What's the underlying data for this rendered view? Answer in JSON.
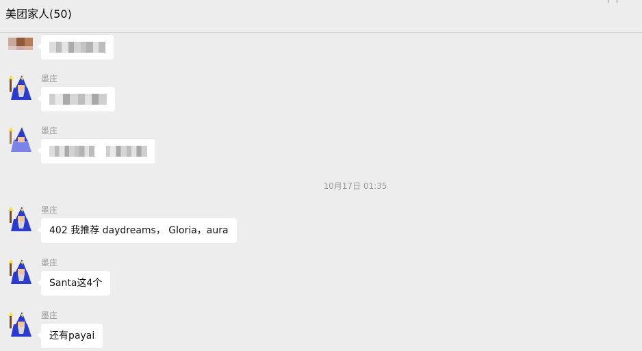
{
  "header": {
    "chat_title": "美团家人(50)"
  },
  "messages": [
    {
      "sender": "",
      "content_blurred": true
    },
    {
      "sender": "墨庄",
      "content_blurred": true
    },
    {
      "sender": "墨庄",
      "content_blurred": true
    },
    {
      "sender": "墨庄",
      "text": "402 我推荐 daydreams， Gloria，aura"
    },
    {
      "sender": "墨庄",
      "text": "Santa这4个"
    },
    {
      "sender": "墨庄",
      "text": "还有payai"
    }
  ],
  "timestamp": "10月17日 01:35",
  "avatar_icon": "wizard-avatar-icon",
  "colors": {
    "background": "#ededed",
    "bubble": "#ffffff",
    "sender_text": "#999999",
    "wizard_robe": "#2b3bd0"
  }
}
